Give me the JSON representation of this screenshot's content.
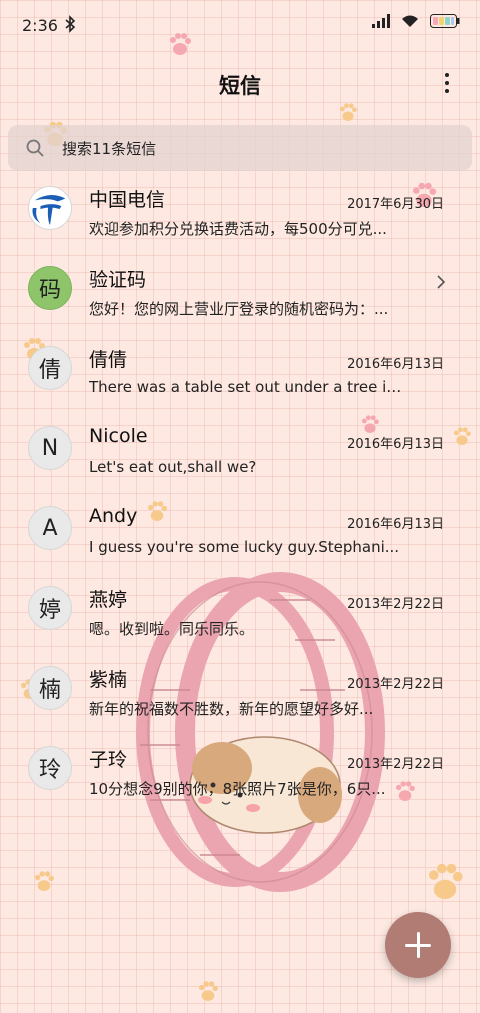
{
  "status_bar": {
    "time": "2:36",
    "icons": [
      "bluetooth-icon",
      "signal-icon",
      "wifi-icon",
      "battery-icon"
    ]
  },
  "app_bar": {
    "title": "短信",
    "menu_icon": "more-vertical-icon"
  },
  "search": {
    "placeholder": "搜索11条短信",
    "icon": "search-icon"
  },
  "conversations": [
    {
      "avatar": "",
      "avatar_type": "telecom-logo",
      "name": "中国电信",
      "date": "2017年6月30日",
      "preview": "欢迎参加积分兑换话费活动，每500分可兑..."
    },
    {
      "avatar": "码",
      "avatar_type": "green",
      "name": "验证码",
      "date": "",
      "preview": "您好！您的网上营业厅登录的随机密码为：...",
      "chevron": "chevron-right-icon"
    },
    {
      "avatar": "倩",
      "name": "倩倩",
      "date": "2016年6月13日",
      "preview": "There was a table set out under a tree in..."
    },
    {
      "avatar": "N",
      "name": "Nicole",
      "date": "2016年6月13日",
      "preview": "Let's eat out,shall we?"
    },
    {
      "avatar": "A",
      "name": "Andy",
      "date": "2016年6月13日",
      "preview": "I guess you're some lucky guy.Stephani..."
    },
    {
      "avatar": "婷",
      "name": "燕婷",
      "date": "2013年2月22日",
      "preview": "嗯。收到啦。同乐同乐。"
    },
    {
      "avatar": "楠",
      "name": "紫楠",
      "date": "2013年2月22日",
      "preview": "新年的祝福数不胜数，新年的愿望好多好..."
    },
    {
      "avatar": "玲",
      "name": "子玲",
      "date": "2013年2月22日",
      "preview": "10分想念9别的你，8张照片7张是你，6只..."
    }
  ],
  "fab": {
    "icon": "plus-icon"
  },
  "colors": {
    "background": "#fde9e2",
    "fab": "#b07c74",
    "wheel": "#eba5b0",
    "avatar_green": "#8ec56b"
  }
}
